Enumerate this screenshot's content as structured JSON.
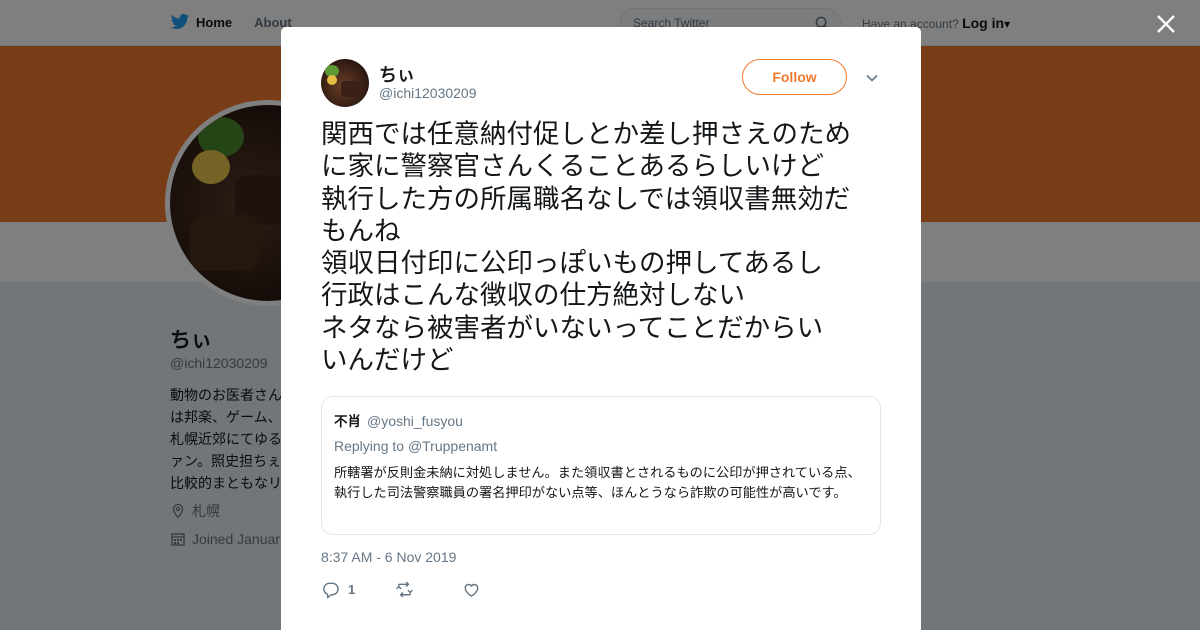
{
  "topbar": {
    "home_label": "Home",
    "about_label": "About",
    "search_placeholder": "Search Twitter",
    "have_account": "Have an account?",
    "login_label": "Log in"
  },
  "profile": {
    "name": "ちぃ",
    "handle": "@ichi12030209",
    "bio_lines": [
      "動物のお医者さん",
      "は邦楽、ゲーム、",
      "札幌近郊にてゆる",
      "ァン。照史担ちぇ",
      "比較的まともなリ"
    ],
    "location": "札幌",
    "joined": "Joined Januar"
  },
  "tweet": {
    "name": "ちぃ",
    "handle": "@ichi12030209",
    "follow_label": "Follow",
    "text": "関西では任意納付促しとか差し押さえのため\nに家に警察官さんくることあるらしいけど\n執行した方の所属職名なしでは領収書無効だ\nもんね\n領収日付印に公印っぽいもの押してあるし\n行政はこんな徴収の仕方絶対しない\nネタなら被害者がいないってことだからい\nいんだけど",
    "quote": {
      "name": "不肖",
      "handle": "@yoshi_fusyou",
      "replying_prefix": "Replying to",
      "replying_to": "@Truppenamt",
      "text": "所轄署が反則金未納に対処しません。また領収書とされるものに公印が押されている点、執行した司法警察職員の署名押印がない点等、ほんとうなら詐欺の可能性が高いです。"
    },
    "timestamp": "8:37 AM - 6 Nov 2019",
    "reply_count": "1",
    "retweet_count": "",
    "like_count": ""
  },
  "colors": {
    "accent": "#f07a2f",
    "twitter_blue": "#1da1f2",
    "muted": "#657786"
  }
}
